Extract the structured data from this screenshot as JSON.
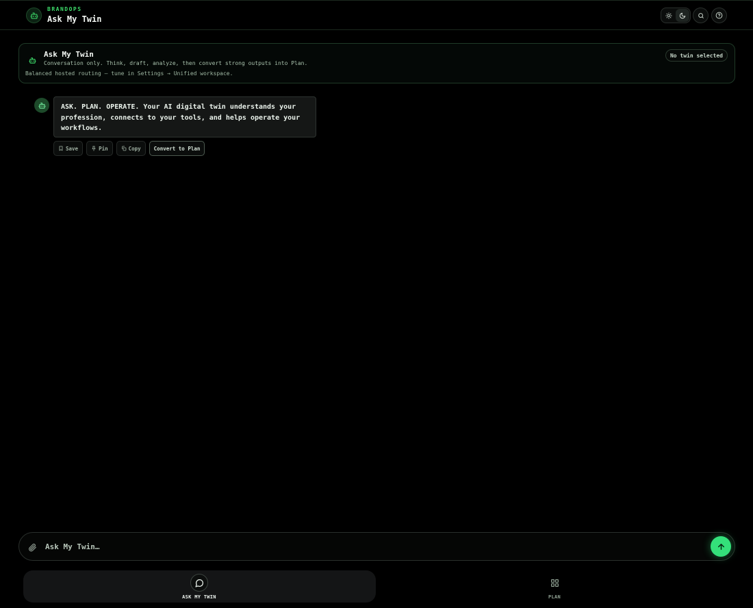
{
  "header": {
    "brand_name": "BRANDOPS",
    "title": "Ask My Twin",
    "icons": [
      "robot-icon",
      "sun-icon",
      "moon-icon",
      "search-icon",
      "help-icon"
    ]
  },
  "info_card": {
    "title": "Ask My Twin",
    "subtitle": "Conversation only. Think, draft, analyze, then convert strong outputs into Plan.",
    "routing": "Balanced hosted routing — tune in Settings → Unified workspace.",
    "twin_badge": "No twin selected"
  },
  "message": {
    "text": "ASK. PLAN. OPERATE. Your AI digital twin understands your profession, connects to your tools, and helps operate your workflows.",
    "actions": {
      "save": "Save",
      "pin": "Pin",
      "copy": "Copy",
      "convert": "Convert to Plan"
    }
  },
  "composer": {
    "placeholder": "Ask My Twin…",
    "value": ""
  },
  "nav": {
    "ask_label": "ASK MY TWIN",
    "plan_label": "PLAN"
  },
  "colors": {
    "accent": "#34e07a",
    "brand_green": "#3ddc6a",
    "background": "#000000"
  }
}
